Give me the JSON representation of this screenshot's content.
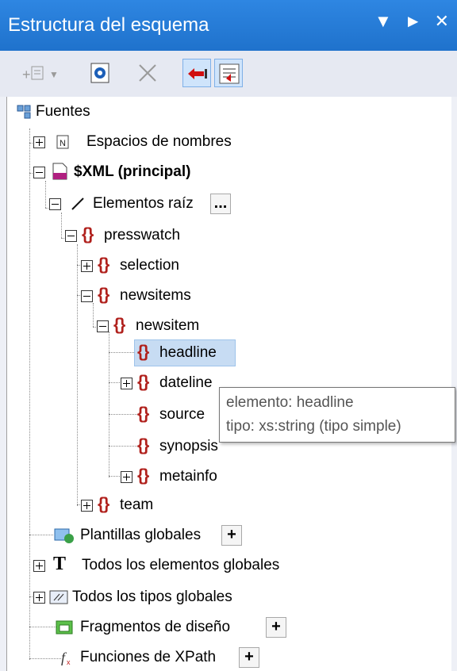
{
  "titlebar": {
    "title": "Estructura del esquema",
    "buttons": [
      "dropdown-arrow",
      "pin",
      "close"
    ]
  },
  "toolbar": {
    "buttons": [
      {
        "name": "add-element-button",
        "state": "disabled"
      },
      {
        "name": "properties-button",
        "state": "normal"
      },
      {
        "name": "delete-button",
        "state": "disabled"
      },
      {
        "name": "collapse-left-button",
        "state": "active"
      },
      {
        "name": "sort-button",
        "state": "active"
      }
    ]
  },
  "tree": {
    "fuentes": "Fuentes",
    "espacios": "Espacios de nombres",
    "xml": "$XML (principal)",
    "raiz": "Elementos raíz",
    "raiz_more": "...",
    "presswatch": "presswatch",
    "selection": "selection",
    "newsitems": "newsitems",
    "newsitem": "newsitem",
    "headline": "headline",
    "dateline": "dateline",
    "source": "source",
    "synopsis": "synopsis",
    "metainfo": "metainfo",
    "team": "team",
    "plantillas": "Plantillas globales",
    "todos_elementos": "Todos los elementos globales",
    "todos_tipos": "Todos los tipos globales",
    "fragmentos": "Fragmentos de diseño",
    "funciones": "Funciones de XPath",
    "add_label": "+"
  },
  "tooltip": {
    "line1": "elemento: headline",
    "line2": "tipo: xs:string (tipo simple)"
  },
  "colors": {
    "titlebar": "#1f72cc",
    "brace": "#b0201c",
    "selection": "#c7dcf3"
  }
}
